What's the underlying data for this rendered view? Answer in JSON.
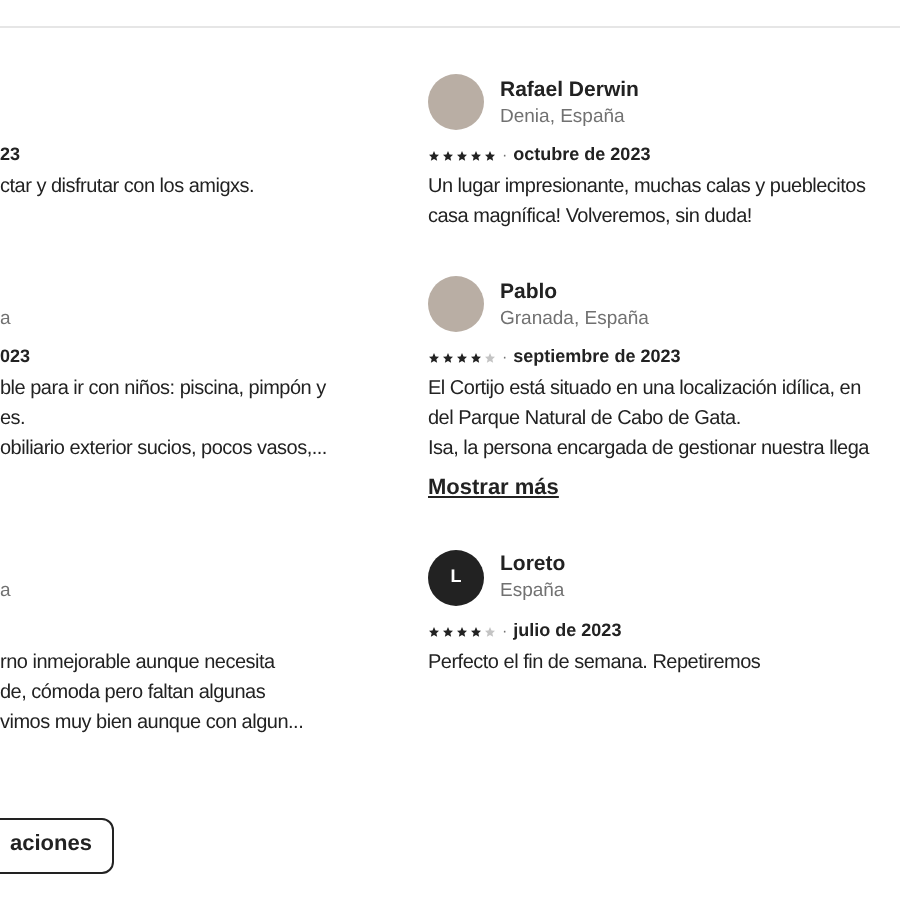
{
  "left_column": {
    "reviews": [
      {
        "date": "23",
        "body": [
          "ctar y disfrutar con los amigxs."
        ]
      },
      {
        "location": "a",
        "date": "023",
        "body": [
          "ble para ir con niños: piscina, pimpón y",
          "es.",
          "obiliario exterior sucios, pocos vasos,..."
        ]
      },
      {
        "location": "a",
        "body": [
          "rno inmejorable aunque necesita",
          "de, cómoda pero faltan algunas",
          "vimos muy bien aunque con algun..."
        ]
      }
    ]
  },
  "right_column": {
    "reviews": [
      {
        "avatar": {
          "kind": "photo"
        },
        "name": "Rafael Derwin",
        "location": "Denia, España",
        "stars": 5,
        "separator": "·",
        "date": "octubre de 2023",
        "body": [
          "Un lugar impresionante, muchas calas y pueblecitos",
          "casa magnífica! Volveremos, sin duda!"
        ]
      },
      {
        "avatar": {
          "kind": "photo"
        },
        "name": "Pablo",
        "location": "Granada, España",
        "stars": 4,
        "separator": "·",
        "date": "septiembre de 2023",
        "body": [
          "El Cortijo está situado en una localización idílica, en",
          "del Parque Natural de Cabo de Gata.",
          "Isa, la persona encargada de gestionar nuestra llega"
        ],
        "more_link": "Mostrar más"
      },
      {
        "avatar": {
          "kind": "initial",
          "letter": "L"
        },
        "name": "Loreto",
        "location": "España",
        "stars": 4,
        "separator": "·",
        "date": "julio de 2023",
        "body": [
          "Perfecto el fin de semana. Repetiremos"
        ]
      }
    ]
  },
  "show_all_button": "aciones"
}
